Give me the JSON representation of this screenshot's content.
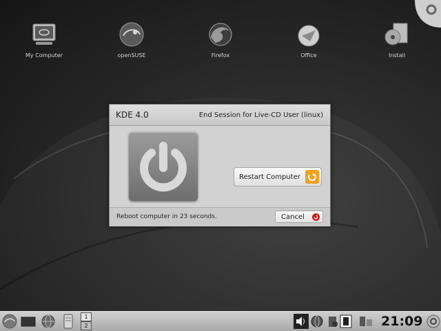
{
  "desktop": {
    "icons": [
      {
        "label": "My Computer",
        "icon": "computer-icon"
      },
      {
        "label": "openSUSE",
        "icon": "opensuse-icon"
      },
      {
        "label": "Firefox",
        "icon": "firefox-icon"
      },
      {
        "label": "Office",
        "icon": "office-icon"
      },
      {
        "label": "Install",
        "icon": "install-icon"
      }
    ]
  },
  "dialog": {
    "kde_title": "KDE 4.0",
    "session_title": "End Session for Live-CD User (linux)",
    "restart_label": "Restart Computer",
    "reboot_text": "Reboot computer in 23 seconds.",
    "cancel_label": "Cancel"
  },
  "panel": {
    "pager": [
      "1",
      "2"
    ],
    "clock": "21:09"
  },
  "colors": {
    "desktop_bg": "#262626",
    "dialog_bg": "#d2d2d2",
    "panel_bg": "#bcbcbc",
    "restart_accent": "#f0a020",
    "cancel_accent": "#c81818"
  }
}
